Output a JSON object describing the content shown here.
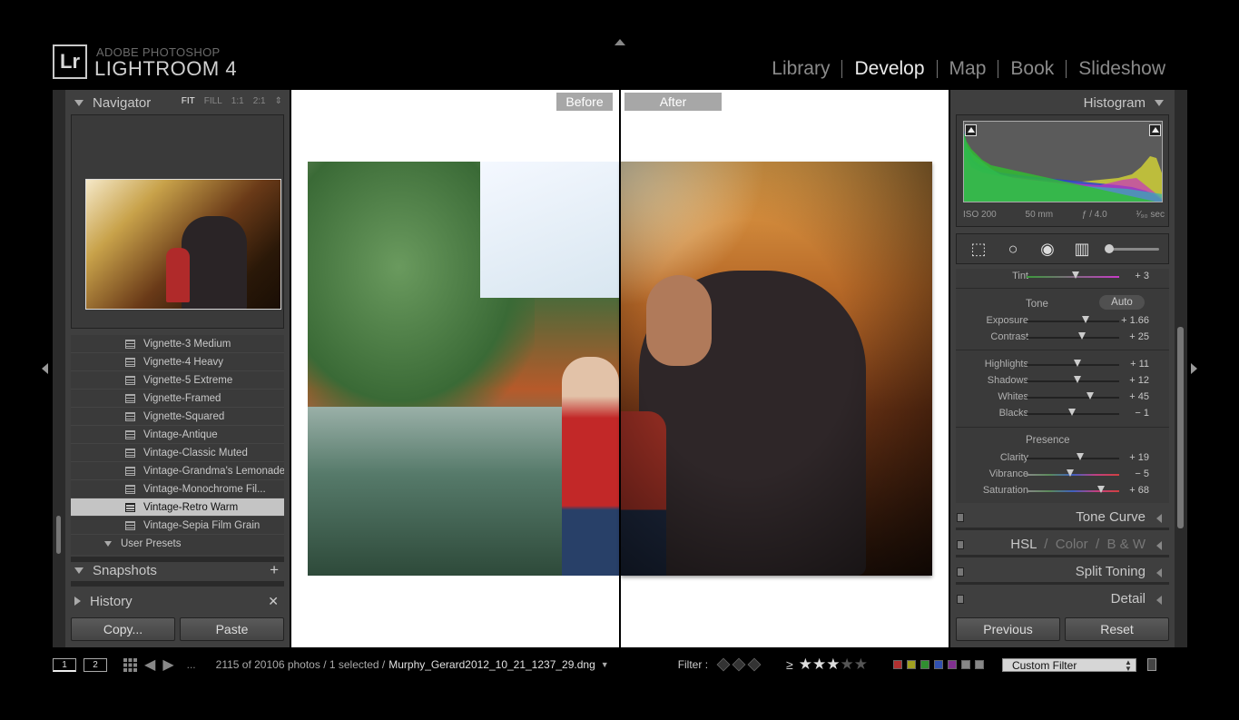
{
  "brand": {
    "logo": "Lr",
    "line1": "ADOBE PHOTOSHOP",
    "line2": "LIGHTROOM 4"
  },
  "modules": [
    "Library",
    "Develop",
    "Map",
    "Book",
    "Slideshow"
  ],
  "active_module": "Develop",
  "left": {
    "navigator": {
      "title": "Navigator",
      "zoom": [
        "FIT",
        "FILL",
        "1:1",
        "2:1"
      ],
      "zoom_selected": "FIT"
    },
    "presets": [
      "Vignette-3 Medium",
      "Vignette-4 Heavy",
      "Vignette-5 Extreme",
      "Vignette-Framed",
      "Vignette-Squared",
      "Vintage-Antique",
      "Vintage-Classic Muted",
      "Vintage-Grandma's Lemonade",
      "Vintage-Monochrome Fil...",
      "Vintage-Retro Warm",
      "Vintage-Sepia Film Grain"
    ],
    "selected_preset": "Vintage-Retro Warm",
    "user_presets": "User Presets",
    "snapshots": "Snapshots",
    "history": "History",
    "copy_btn": "Copy...",
    "paste_btn": "Paste"
  },
  "center": {
    "before": "Before",
    "after": "After"
  },
  "right": {
    "histogram": {
      "title": "Histogram",
      "iso": "ISO 200",
      "focal": "50 mm",
      "aperture": "ƒ / 4.0",
      "shutter": "¹⁄₉₀ sec"
    },
    "tools": [
      "crop-overlay",
      "spot-removal",
      "red-eye",
      "graduated-filter",
      "adjustment-brush"
    ],
    "tint": {
      "label": "Tint",
      "value": "+ 3",
      "pos": 0.53
    },
    "tone_title": "Tone",
    "auto": "Auto",
    "tone": [
      {
        "label": "Exposure",
        "value": "+ 1.66",
        "pos": 0.64
      },
      {
        "label": "Contrast",
        "value": "+ 25",
        "pos": 0.6
      }
    ],
    "tone2": [
      {
        "label": "Highlights",
        "value": "+ 11",
        "pos": 0.55
      },
      {
        "label": "Shadows",
        "value": "+ 12",
        "pos": 0.55
      },
      {
        "label": "Whites",
        "value": "+ 45",
        "pos": 0.69
      },
      {
        "label": "Blacks",
        "value": "− 1",
        "pos": 0.49
      }
    ],
    "presence_title": "Presence",
    "presence": [
      {
        "label": "Clarity",
        "value": "+ 19",
        "pos": 0.58
      },
      {
        "label": "Vibrance",
        "value": "− 5",
        "pos": 0.47
      },
      {
        "label": "Saturation",
        "value": "+ 68",
        "pos": 0.8
      }
    ],
    "panels": {
      "tone_curve": "Tone Curve",
      "hsl": "HSL",
      "color": "Color",
      "bw": "B & W",
      "split_toning": "Split Toning",
      "detail": "Detail"
    },
    "previous_btn": "Previous",
    "reset_btn": "Reset"
  },
  "filmstrip": {
    "screen1": "1",
    "screen2": "2",
    "dots": "...",
    "count": "2115 of 20106 photos / 1 selected /",
    "filename": "Murphy_Gerard2012_10_21_1237_29.dng",
    "filter_label": "Filter :",
    "ge": "≥",
    "stars_on": 3,
    "stars_total": 5,
    "custom_filter": "Custom Filter",
    "color_labels": [
      "#b03030",
      "#a0a020",
      "#309030",
      "#3050b0",
      "#803090",
      "#888888",
      "#888888"
    ]
  }
}
